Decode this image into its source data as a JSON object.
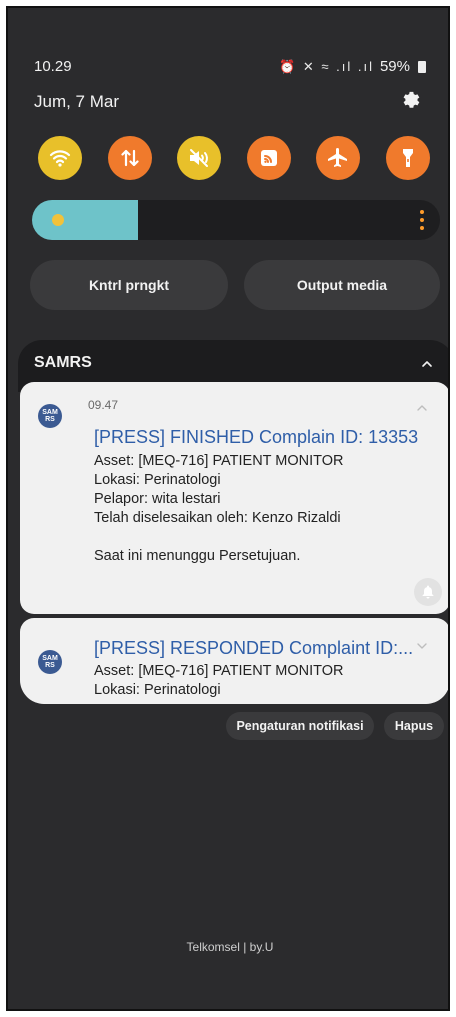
{
  "status_bar": {
    "time": "10.29",
    "battery": "59%",
    "icons_text": "⏰ ✕ ≈ .ıl .ıl"
  },
  "date": "Jum, 7 Mar",
  "quick_settings": [
    {
      "name": "wifi",
      "color": "#e8c02a"
    },
    {
      "name": "mobile-data",
      "color": "#f07a2c"
    },
    {
      "name": "mute",
      "color": "#e8c02a"
    },
    {
      "name": "hotspot",
      "color": "#f07a2c"
    },
    {
      "name": "airplane",
      "color": "#f07a2c"
    },
    {
      "name": "flashlight",
      "color": "#f07a2c"
    }
  ],
  "brightness": {
    "level": 0.26,
    "fill_color": "#6ec3c9"
  },
  "pills": {
    "device_control": "Kntrl prngkt",
    "media_output": "Output media"
  },
  "notification_group": {
    "app_name": "SAMRS",
    "avatar_text": "SAM RS",
    "notifications": [
      {
        "time": "09.47",
        "title": "[PRESS] FINISHED Complain ID: 13353",
        "lines": [
          "Asset: [MEQ-716] PATIENT MONITOR",
          "Lokasi: Perinatologi",
          "Pelapor: wita lestari",
          "Telah diselesaikan oleh: Kenzo Rizaldi",
          "",
          "Saat ini menunggu Persetujuan."
        ]
      },
      {
        "title": "[PRESS] RESPONDED Complaint ID:...",
        "lines": [
          "Asset: [MEQ-716] PATIENT MONITOR",
          "Lokasi: Perinatologi"
        ]
      }
    ]
  },
  "actions": {
    "notification_settings": "Pengaturan notifikasi",
    "clear": "Hapus"
  },
  "carrier": "Telkomsel | by.U"
}
